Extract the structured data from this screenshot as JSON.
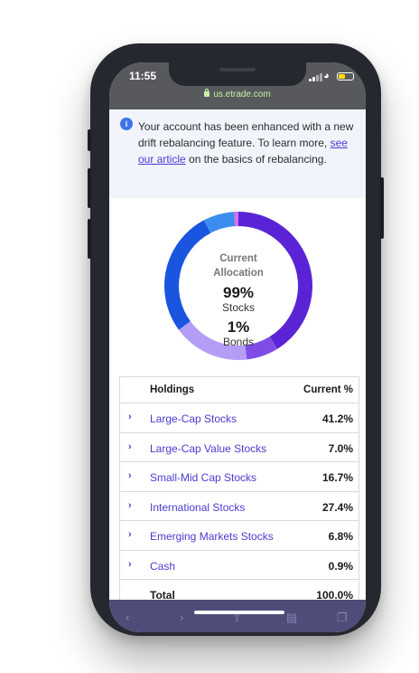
{
  "status_bar": {
    "time": "11:55",
    "url": "us.etrade.com",
    "icons": [
      "signal-icon",
      "wifi-icon",
      "battery-icon",
      "lock-icon"
    ],
    "battery_color": "#ffe000"
  },
  "banner": {
    "text_before": "Your account has been enhanced with a new drift rebalancing feature. To learn more, ",
    "link_text": "see our article",
    "text_after": " on the basics of rebalancing.",
    "icon": "info-icon"
  },
  "allocation": {
    "title_line1": "Current",
    "title_line2": "Allocation",
    "stocks_pct": "99%",
    "stocks_label": "Stocks",
    "bonds_pct": "1%",
    "bonds_label": "Bonds",
    "segments": [
      {
        "value": 41.2,
        "color": "#5a24d6"
      },
      {
        "value": 7.0,
        "color": "#7f4de6"
      },
      {
        "value": 16.7,
        "color": "#b39df7"
      },
      {
        "value": 27.4,
        "color": "#1a55e0"
      },
      {
        "value": 6.8,
        "color": "#3b8ef0"
      },
      {
        "value": 0.9,
        "color": "#d970e8"
      }
    ]
  },
  "holdings": {
    "header_name": "Holdings",
    "header_pct": "Current %",
    "rows": [
      {
        "name": "Large-Cap Stocks",
        "pct": "41.2%"
      },
      {
        "name": "Large-Cap Value Stocks",
        "pct": "7.0%"
      },
      {
        "name": "Small-Mid Cap Stocks",
        "pct": "16.7%"
      },
      {
        "name": "International Stocks",
        "pct": "27.4%"
      },
      {
        "name": "Emerging Markets Stocks",
        "pct": "6.8%"
      },
      {
        "name": "Cash",
        "pct": "0.9%"
      }
    ],
    "total_label": "Total",
    "total_pct": "100.0%"
  },
  "toolbar": {
    "icons": [
      "back-icon",
      "forward-icon",
      "share-icon",
      "bookmarks-icon",
      "tabs-icon"
    ]
  },
  "colors": {
    "accent": "#4a3bd1",
    "phone_frame": "#25282e"
  }
}
